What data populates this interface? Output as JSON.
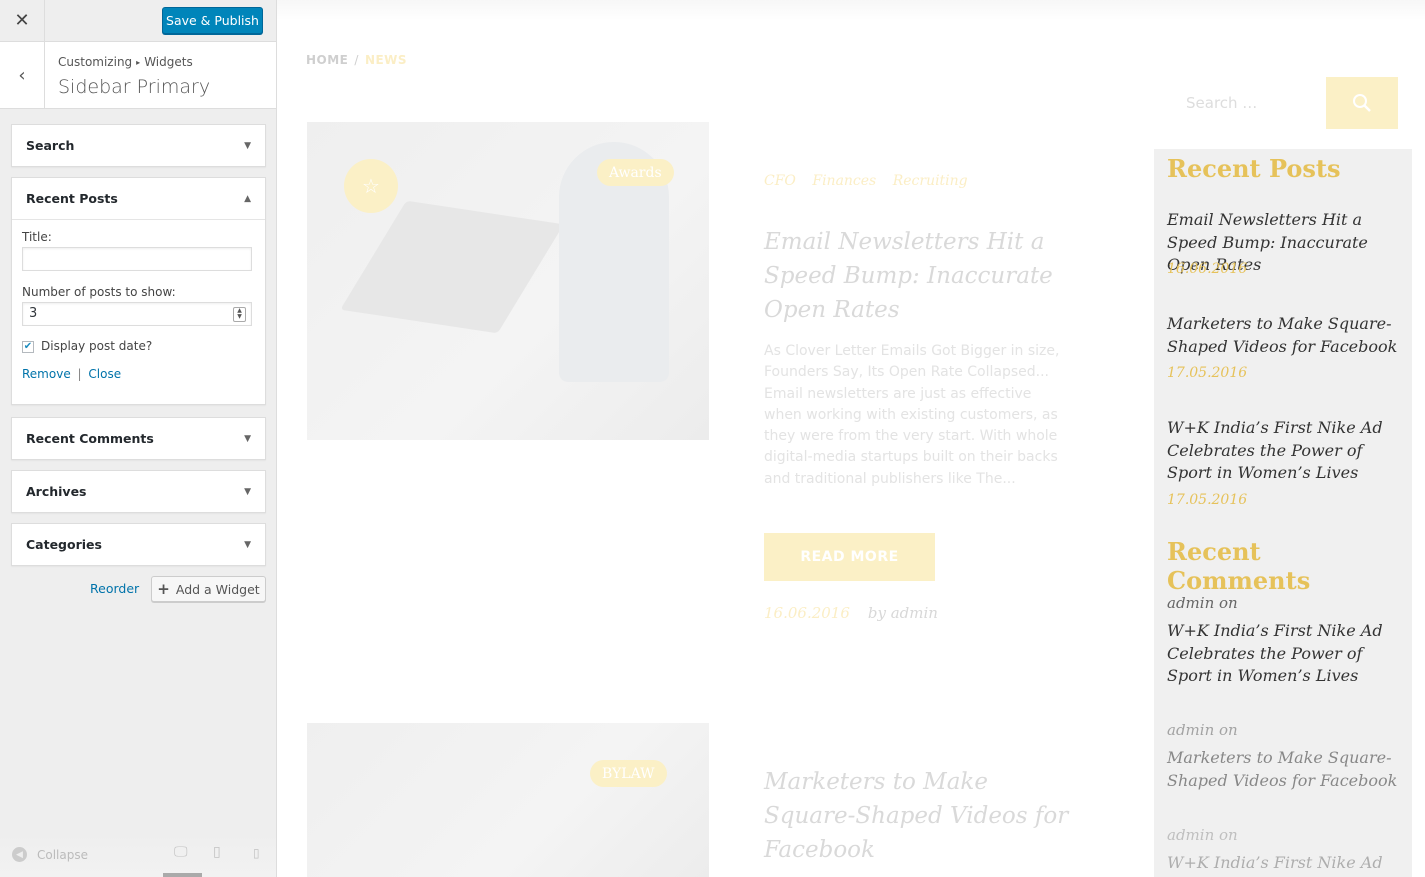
{
  "customizer": {
    "close_icon": "close-icon",
    "save_label": "Save & Publish",
    "breadcrumb": {
      "first": "Customizing",
      "second": "Widgets"
    },
    "section_title": "Sidebar Primary",
    "widgets": {
      "search": "Search",
      "recent_posts": "Recent Posts",
      "recent_comments": "Recent Comments",
      "archives": "Archives",
      "categories": "Categories"
    },
    "recent_posts_form": {
      "title_label": "Title:",
      "title_value": "",
      "count_label": "Number of posts to show:",
      "count_value": "3",
      "show_date_label": "Display post date?",
      "show_date_checked": true,
      "remove_label": "Remove",
      "close_label": "Close"
    },
    "reorder_label": "Reorder",
    "add_widget_label": "Add a Widget",
    "collapse_label": "Collapse",
    "accent_color": "#0085ba"
  },
  "preview": {
    "breadcrumb": {
      "home": "HOME",
      "current": "NEWS"
    },
    "search": {
      "placeholder": "Search …"
    },
    "posts": [
      {
        "tag": "Awards",
        "categories": [
          "CFO",
          "Finances",
          "Recruiting"
        ],
        "title": "Email Newsletters Hit a Speed Bump: Inaccurate Open Rates",
        "excerpt": "As Clover Letter Emails Got Bigger in size, Founders Say, Its Open Rate Collapsed... Email newsletters are just as effective when working with existing customers, as they were from the very start. With whole digital-media startups built on their backs and traditional publishers like The...",
        "read_more": "READ MORE",
        "date": "16.06.2016",
        "author": "by admin"
      },
      {
        "tag": "BYLAW",
        "title": "Marketers to Make Square-Shaped Videos for Facebook"
      }
    ],
    "sidebar": {
      "recent_posts_heading": "Recent Posts",
      "recent_posts": [
        {
          "title": "Email Newsletters Hit a Speed Bump: Inaccurate Open Rates",
          "date": "16.06.2016"
        },
        {
          "title": "Marketers to Make Square-Shaped Videos for Facebook",
          "date": "17.05.2016"
        },
        {
          "title": "W+K India’s First Nike Ad Celebrates the Power of Sport in Women’s Lives",
          "date": "17.05.2016"
        }
      ],
      "recent_comments_heading": "Recent Comments",
      "recent_comments": [
        {
          "author": "admin on",
          "post": "W+K India’s First Nike Ad Celebrates the Power of Sport in Women’s Lives"
        },
        {
          "author": "admin on",
          "post": "Marketers to Make Square-Shaped Videos for Facebook"
        },
        {
          "author": "admin on",
          "post": "W+K India’s First Nike Ad"
        }
      ]
    },
    "accent_color": "#e6c25a"
  }
}
